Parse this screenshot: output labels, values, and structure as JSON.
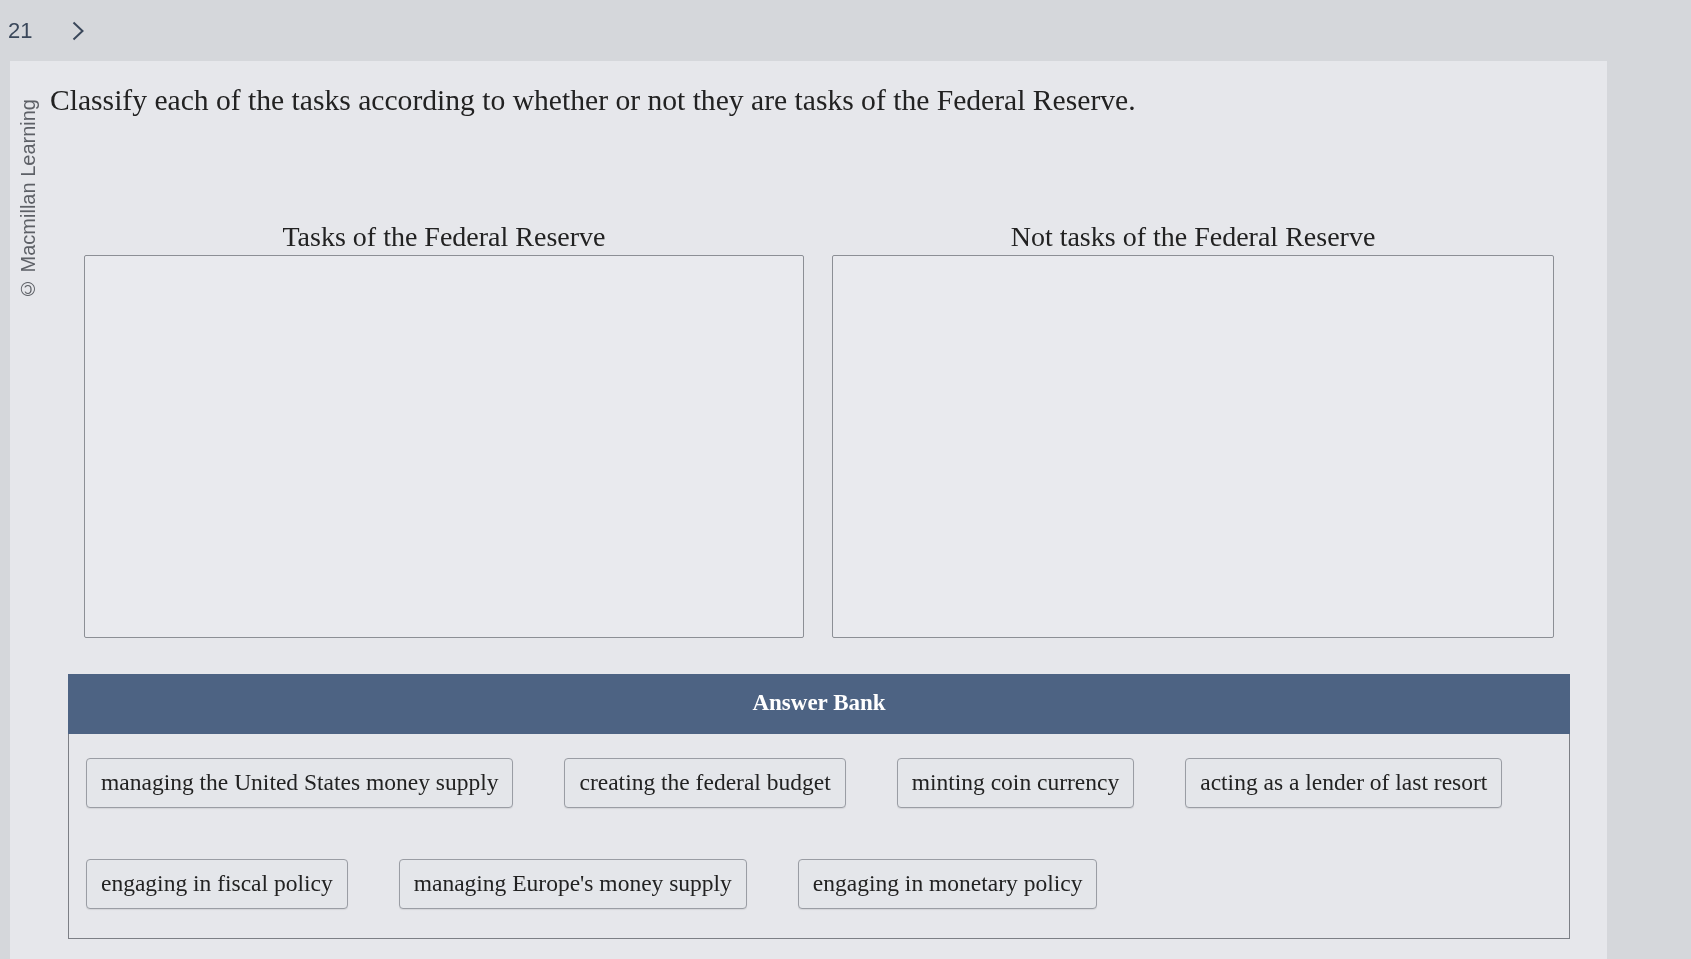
{
  "top_bar": {
    "question_number": "21"
  },
  "copyright": "© Macmillan Learning",
  "prompt": "Classify each of the tasks according to whether or not they are tasks of the Federal Reserve.",
  "categories": [
    {
      "title": "Tasks of the Federal Reserve"
    },
    {
      "title": "Not tasks of the Federal Reserve"
    }
  ],
  "answer_bank": {
    "title": "Answer Bank",
    "items": [
      "managing the United States money supply",
      "creating the federal budget",
      "minting coin currency",
      "acting as a lender of last resort",
      "engaging in fiscal policy",
      "managing Europe's money supply",
      "engaging in monetary policy"
    ]
  }
}
